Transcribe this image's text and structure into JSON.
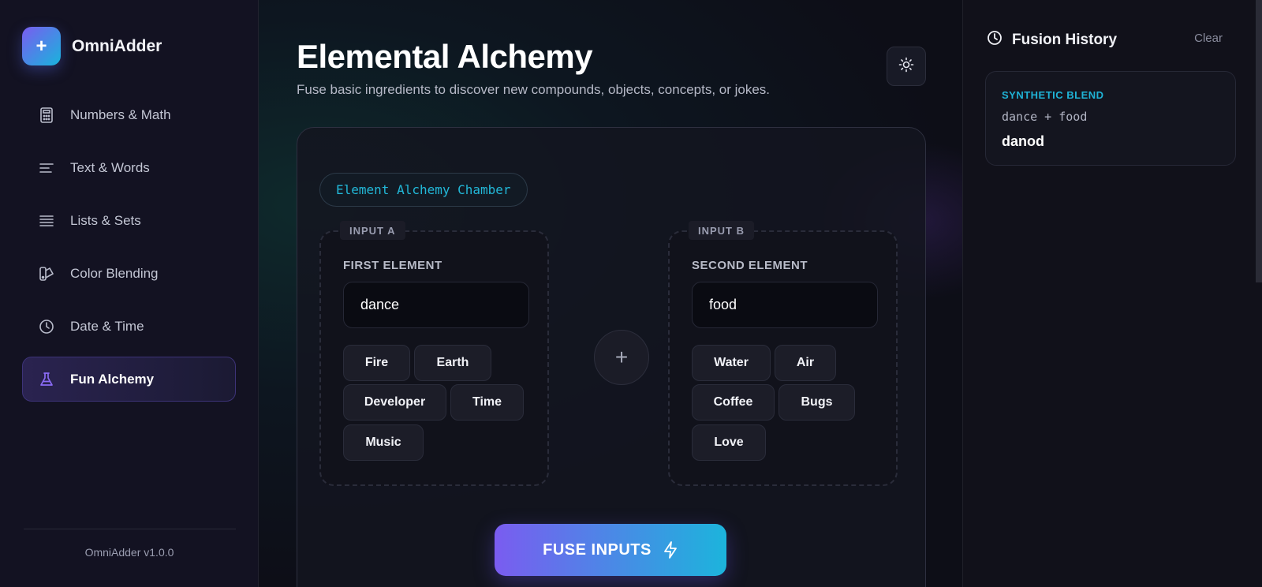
{
  "app": {
    "name": "OmniAdder",
    "version": "OmniAdder v1.0.0"
  },
  "sidebar": {
    "items": [
      {
        "label": "Numbers & Math",
        "icon": "calculator-icon"
      },
      {
        "label": "Text & Words",
        "icon": "text-lines-icon"
      },
      {
        "label": "Lists & Sets",
        "icon": "list-icon"
      },
      {
        "label": "Color Blending",
        "icon": "swatch-icon"
      },
      {
        "label": "Date & Time",
        "icon": "clock-icon"
      },
      {
        "label": "Fun Alchemy",
        "icon": "flask-icon",
        "active": true
      }
    ]
  },
  "main": {
    "title": "Elemental Alchemy",
    "subtitle": "Fuse basic ingredients to discover new compounds, objects, concepts, or jokes.",
    "chamber_tag": "Element Alchemy Chamber",
    "input_a": {
      "badge": "INPUT A",
      "label": "FIRST ELEMENT",
      "value": "dance",
      "chips": [
        "Fire",
        "Earth",
        "Developer",
        "Time",
        "Music"
      ]
    },
    "input_b": {
      "badge": "INPUT B",
      "label": "SECOND ELEMENT",
      "value": "food",
      "chips": [
        "Water",
        "Air",
        "Coffee",
        "Bugs",
        "Love"
      ]
    },
    "plus_symbol": "+",
    "fuse_label": "FUSE INPUTS"
  },
  "history": {
    "title": "Fusion History",
    "clear_label": "Clear",
    "entries": [
      {
        "type": "SYNTHETIC BLEND",
        "equation": "dance + food",
        "result": "danod"
      }
    ]
  },
  "colors": {
    "accent_purple": "#7a5cf0",
    "accent_cyan": "#1cb4dc",
    "background": "#0d0e17"
  }
}
